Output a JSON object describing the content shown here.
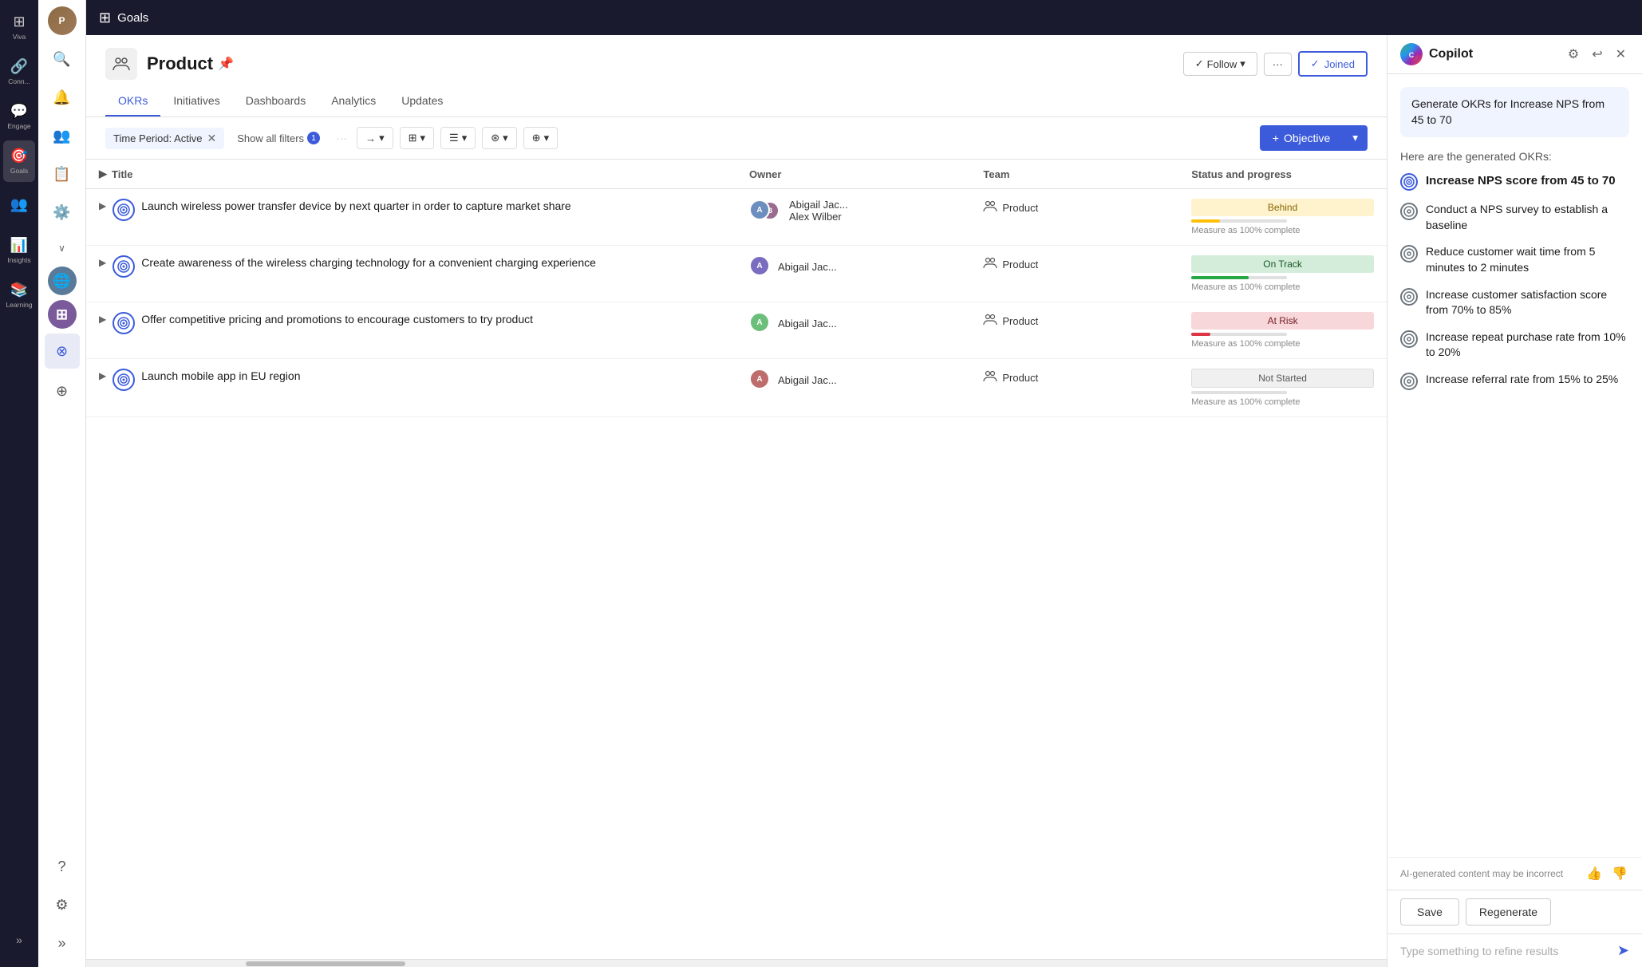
{
  "app": {
    "top_bar_title": "Goals",
    "grid_icon": "⊞"
  },
  "nav_rail": {
    "items": [
      {
        "id": "viva",
        "label": "Viva",
        "icon": "⊞"
      },
      {
        "id": "connections",
        "label": "Connections",
        "icon": "🔗"
      },
      {
        "id": "engage",
        "label": "Engage",
        "icon": "💬"
      },
      {
        "id": "goals",
        "label": "Goals",
        "icon": "🎯",
        "active": true
      },
      {
        "id": "people",
        "label": "",
        "icon": "👥"
      },
      {
        "id": "insights",
        "label": "Insights",
        "icon": "📊"
      },
      {
        "id": "learning",
        "label": "Learning",
        "icon": "📚"
      }
    ]
  },
  "sidebar": {
    "icons": [
      {
        "id": "search",
        "icon": "🔍"
      },
      {
        "id": "bell",
        "icon": "🔔"
      },
      {
        "id": "group",
        "icon": "👥"
      },
      {
        "id": "list",
        "icon": "📋"
      },
      {
        "id": "settings",
        "icon": "⚙️"
      }
    ],
    "avatar": "A",
    "avatar2_initials": "P",
    "bottom_icons": [
      {
        "id": "help",
        "icon": "?"
      },
      {
        "id": "settings2",
        "icon": "⚙"
      },
      {
        "id": "expand",
        "icon": "»"
      }
    ]
  },
  "page": {
    "icon": "⊞",
    "title": "Product",
    "pin_icon": "📌",
    "tabs": [
      {
        "id": "okrs",
        "label": "OKRs",
        "active": true
      },
      {
        "id": "initiatives",
        "label": "Initiatives"
      },
      {
        "id": "dashboards",
        "label": "Dashboards"
      },
      {
        "id": "analytics",
        "label": "Analytics"
      },
      {
        "id": "updates",
        "label": "Updates"
      }
    ],
    "follow_label": "Follow",
    "joined_label": "Joined"
  },
  "toolbar": {
    "filter_label": "Time Period: Active",
    "show_filters_label": "Show all filters",
    "filter_badge": "1",
    "more_icon": "···",
    "views": [
      {
        "id": "list",
        "icon": "≡",
        "label": ""
      },
      {
        "id": "grid",
        "icon": "⊞",
        "label": ""
      },
      {
        "id": "table",
        "icon": "⊟",
        "label": ""
      },
      {
        "id": "connect",
        "icon": "↔",
        "label": ""
      },
      {
        "id": "extra",
        "icon": "⊕",
        "label": ""
      }
    ],
    "add_objective_label": "Objective"
  },
  "table": {
    "columns": [
      "Title",
      "Owner",
      "Team",
      "Status and progress"
    ],
    "rows": [
      {
        "id": 1,
        "title": "Launch wireless power transfer device by next quarter in order to capture market share",
        "owner_name": "Abigail Jac...\nAlex Wilber",
        "owner_name1": "Abigail Jac...",
        "owner_name2": "Alex Wilber",
        "team": "Product",
        "status": "Behind",
        "status_type": "behind",
        "measure": "Measure as 100% complete",
        "progress": 30
      },
      {
        "id": 2,
        "title": "Create awareness of the wireless charging technology for a convenient charging experience",
        "owner_name": "Abigail Jac...",
        "owner_name1": "Abigail Jac...",
        "owner_name2": "",
        "team": "Product",
        "status": "On Track",
        "status_type": "on-track",
        "measure": "Measure as 100% complete",
        "progress": 60
      },
      {
        "id": 3,
        "title": "Offer competitive pricing and promotions to encourage customers to try product",
        "owner_name": "Abigail Jac...",
        "owner_name1": "Abigail Jac...",
        "owner_name2": "",
        "team": "Product",
        "status": "At Risk",
        "status_type": "at-risk",
        "measure": "Measure as 100% complete",
        "progress": 20
      },
      {
        "id": 4,
        "title": "Launch mobile app in EU region",
        "owner_name": "Abigail Jac...",
        "owner_name1": "Abigail Jac...",
        "owner_name2": "",
        "team": "Product",
        "status": "Not Started",
        "status_type": "not-started",
        "measure": "Measure as 100% complete",
        "progress": 0
      }
    ]
  },
  "copilot": {
    "title": "Copilot",
    "prompt": "Generate OKRs for Increase NPS from 45 to 70",
    "response_label": "Here are the generated OKRs:",
    "okrs": [
      {
        "type": "main",
        "text": "Increase NPS score from 45 to 70"
      },
      {
        "type": "kr",
        "text": "Conduct a NPS survey to establish a baseline"
      },
      {
        "type": "kr",
        "text": "Reduce customer wait time from 5 minutes to 2 minutes"
      },
      {
        "type": "kr",
        "text": "Increase customer satisfaction score from 70% to 85%"
      },
      {
        "type": "kr",
        "text": "Increase repeat purchase rate from 10% to 20%"
      },
      {
        "type": "kr",
        "text": "Increase referral rate from 15% to 25%"
      }
    ],
    "footer_note": "AI-generated content may be incorrect",
    "save_label": "Save",
    "regenerate_label": "Regenerate",
    "input_placeholder": "Type something to refine results"
  }
}
